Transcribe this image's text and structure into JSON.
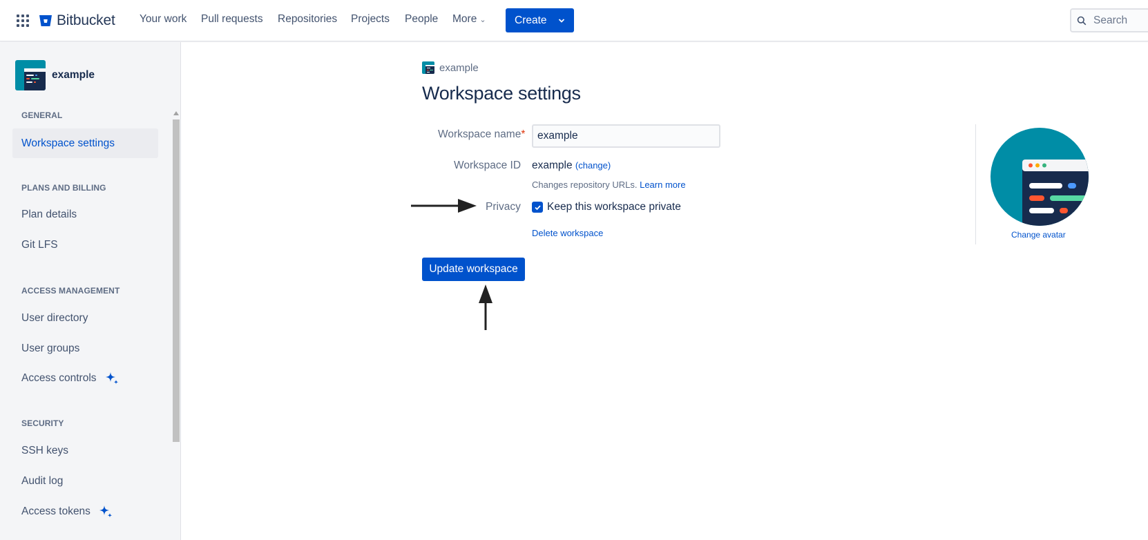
{
  "topnav": {
    "logo_text": "Bitbucket",
    "items": [
      "Your work",
      "Pull requests",
      "Repositories",
      "Projects",
      "People",
      "More"
    ],
    "create_label": "Create",
    "search_placeholder": "Search"
  },
  "sidebar": {
    "workspace_name": "example",
    "sections": [
      {
        "title": "GENERAL",
        "items": [
          {
            "label": "Workspace settings",
            "active": true
          }
        ]
      },
      {
        "title": "PLANS AND BILLING",
        "items": [
          {
            "label": "Plan details"
          },
          {
            "label": "Git LFS"
          }
        ]
      },
      {
        "title": "ACCESS MANAGEMENT",
        "items": [
          {
            "label": "User directory"
          },
          {
            "label": "User groups"
          },
          {
            "label": "Access controls",
            "icon": "sparkle-icon"
          }
        ]
      },
      {
        "title": "SECURITY",
        "items": [
          {
            "label": "SSH keys"
          },
          {
            "label": "Audit log"
          },
          {
            "label": "Access tokens",
            "icon": "sparkle-icon"
          }
        ]
      }
    ]
  },
  "main": {
    "breadcrumb": "example",
    "title": "Workspace settings",
    "workspace_name_label": "Workspace name",
    "required_mark": "*",
    "workspace_name_value": "example",
    "workspace_id_label": "Workspace ID",
    "workspace_id_value": "example",
    "change_link": "(change)",
    "helper_text": "Changes repository URLs.",
    "learn_more": "Learn more",
    "privacy_label": "Privacy",
    "privacy_checkbox_label": "Keep this workspace private",
    "privacy_checked": true,
    "delete_link": "Delete workspace",
    "update_button": "Update workspace",
    "change_avatar": "Change avatar"
  },
  "colors": {
    "brand": "#0052cc",
    "avatar_teal": "#008da6",
    "text": "#172b4d",
    "muted": "#5e6c84"
  }
}
